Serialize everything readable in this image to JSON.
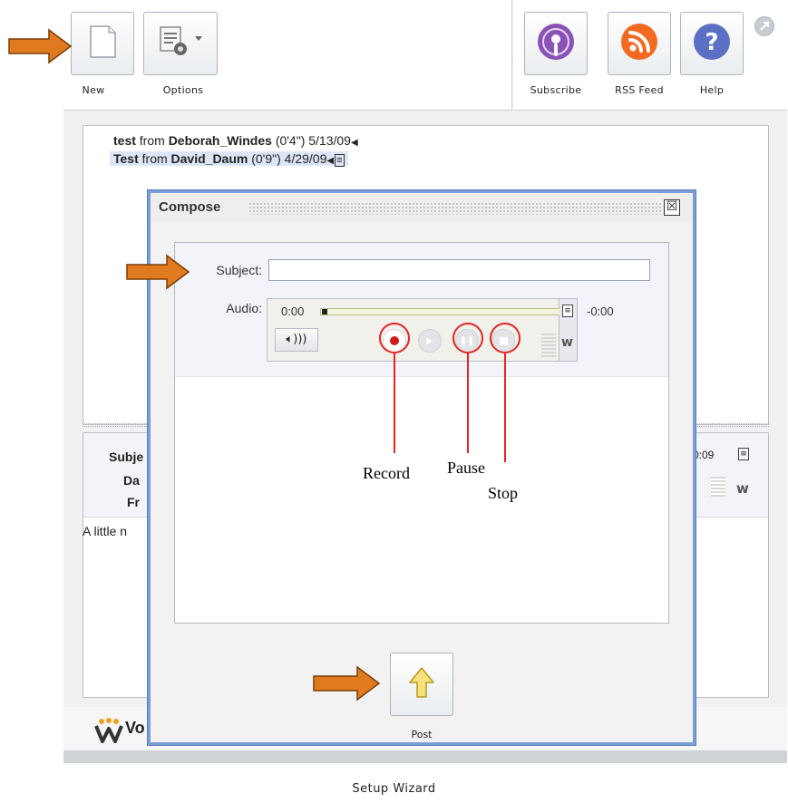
{
  "toolbar": {
    "new_label": "New",
    "options_label": "Options",
    "subscribe_label": "Subscribe",
    "rss_label": "RSS Feed",
    "help_label": "Help"
  },
  "messages": [
    {
      "subject": "test",
      "from_word": "from",
      "author": "Deborah_Windes",
      "duration": "(0'4\")",
      "date": "5/13/09"
    },
    {
      "subject": "Test",
      "from_word": "from",
      "author": "David_Daum",
      "duration": "(0'9\")",
      "date": "4/29/09"
    }
  ],
  "details": {
    "subject_label_partial": "Subje",
    "date_label_partial": "Da",
    "from_label_partial": "Fr",
    "body_partial": "A little n",
    "time_remaining_partial": "0:09",
    "brand_partial": "Vo"
  },
  "compose": {
    "title": "Compose",
    "close_glyph": "☒",
    "subject_label": "Subject:",
    "subject_value": "",
    "audio_label": "Audio:",
    "time_elapsed": "0:00",
    "time_remaining": "-0:00",
    "post_label": "Post"
  },
  "annotations": {
    "record": "Record",
    "pause": "Pause",
    "stop": "Stop"
  },
  "footer": {
    "setup_wizard": "Setup Wizard"
  },
  "colors": {
    "arrow": "#e07a1f",
    "annotation": "#e32626",
    "dialog_border": "#7c9ed7",
    "rss": "#f26a21",
    "subscribe": "#8a52b7",
    "help": "#5b6fc4"
  }
}
